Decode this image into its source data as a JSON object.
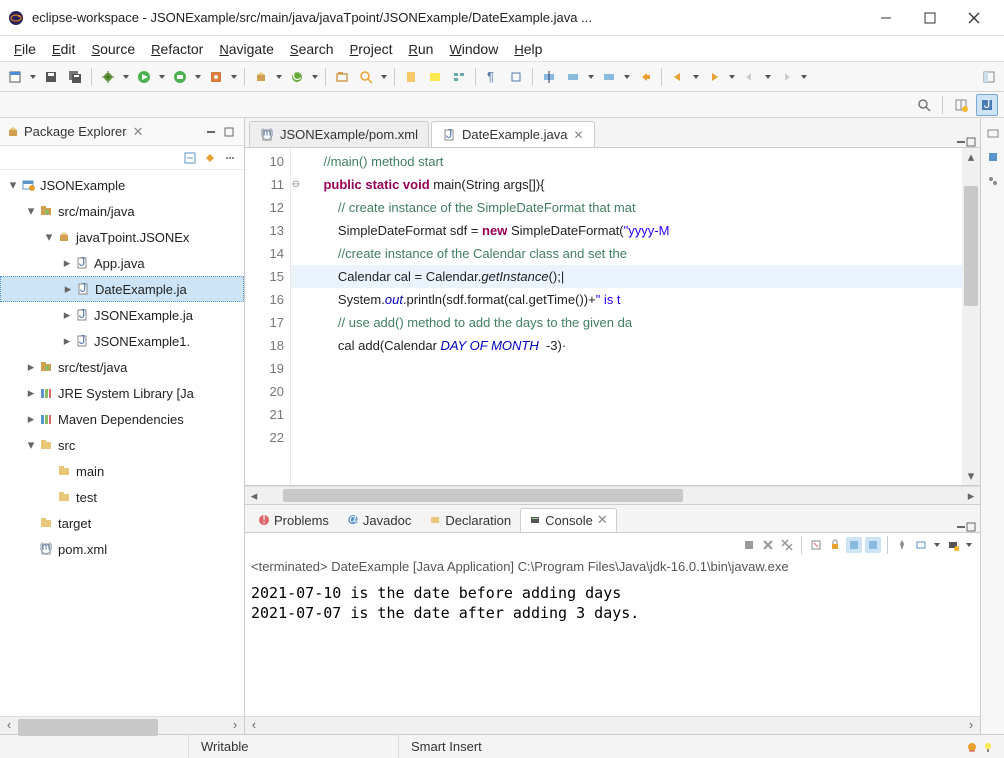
{
  "window": {
    "title": "eclipse-workspace - JSONExample/src/main/java/javaTpoint/JSONExample/DateExample.java ..."
  },
  "menu": [
    "File",
    "Edit",
    "Source",
    "Refactor",
    "Navigate",
    "Search",
    "Project",
    "Run",
    "Window",
    "Help"
  ],
  "packageExplorer": {
    "title": "Package Explorer",
    "items": [
      {
        "depth": 0,
        "exp": "down",
        "icon": "project",
        "label": "JSONExample"
      },
      {
        "depth": 1,
        "exp": "down",
        "icon": "srcfolder",
        "label": "src/main/java"
      },
      {
        "depth": 2,
        "exp": "down",
        "icon": "package",
        "label": "javaTpoint.JSONEx"
      },
      {
        "depth": 3,
        "exp": "right",
        "icon": "jfile",
        "label": "App.java"
      },
      {
        "depth": 3,
        "exp": "right",
        "icon": "jfile",
        "label": "DateExample.ja",
        "selected": true
      },
      {
        "depth": 3,
        "exp": "right",
        "icon": "jfile",
        "label": "JSONExample.ja"
      },
      {
        "depth": 3,
        "exp": "right",
        "icon": "jfile",
        "label": "JSONExample1."
      },
      {
        "depth": 1,
        "exp": "right",
        "icon": "srcfolder",
        "label": "src/test/java"
      },
      {
        "depth": 1,
        "exp": "right",
        "icon": "library",
        "label": "JRE System Library [Ja"
      },
      {
        "depth": 1,
        "exp": "right",
        "icon": "library",
        "label": "Maven Dependencies"
      },
      {
        "depth": 1,
        "exp": "down",
        "icon": "folder",
        "label": "src"
      },
      {
        "depth": 2,
        "exp": "",
        "icon": "folder",
        "label": "main"
      },
      {
        "depth": 2,
        "exp": "",
        "icon": "folder",
        "label": "test"
      },
      {
        "depth": 1,
        "exp": "",
        "icon": "folder",
        "label": "target"
      },
      {
        "depth": 1,
        "exp": "",
        "icon": "xml",
        "label": "pom.xml"
      }
    ]
  },
  "editorTabs": [
    {
      "label": "JSONExample/pom.xml",
      "active": false,
      "icon": "xml"
    },
    {
      "label": "DateExample.java",
      "active": true,
      "icon": "jfile",
      "close": true
    }
  ],
  "code": {
    "startLine": 10,
    "lines": [
      {
        "n": 10,
        "html": "    <span class='cm'>//main() method start</span>"
      },
      {
        "n": 11,
        "html": "    <span class='kw'>public static void</span> main(String args[]){",
        "minus": true
      },
      {
        "n": 12,
        "html": ""
      },
      {
        "n": 13,
        "html": "        <span class='cm'>// create instance of the SimpleDateFormat that mat</span>"
      },
      {
        "n": 14,
        "html": "        SimpleDateFormat sdf = <span class='kw'>new</span> SimpleDateFormat(<span class='str'>\"yyyy-M</span>"
      },
      {
        "n": 15,
        "html": ""
      },
      {
        "n": 16,
        "html": "        <span class='cm'>//create instance of the Calendar class and set the</span>"
      },
      {
        "n": 17,
        "html": "        Calendar cal = Calendar.<span class='it'>getInstance</span>();|",
        "hl": true
      },
      {
        "n": 18,
        "html": ""
      },
      {
        "n": 19,
        "html": "        System.<span class='st'>out</span>.println(sdf.format(cal.getTime())+<span class='str'>\" is t</span>"
      },
      {
        "n": 20,
        "html": ""
      },
      {
        "n": 21,
        "html": "        <span class='cm'>// use add() method to add the days to the given da</span>"
      },
      {
        "n": 22,
        "html": "        cal add(Calendar <span class='st'>DAY OF MONTH</span>  -3)·"
      }
    ]
  },
  "bottomTabs": [
    {
      "label": "Problems",
      "icon": "problems"
    },
    {
      "label": "Javadoc",
      "icon": "javadoc"
    },
    {
      "label": "Declaration",
      "icon": "declaration"
    },
    {
      "label": "Console",
      "icon": "console",
      "active": true,
      "close": true
    }
  ],
  "console": {
    "status": "<terminated> DateExample [Java Application] C:\\Program Files\\Java\\jdk-16.0.1\\bin\\javaw.exe",
    "lines": [
      "2021-07-10 is the date before adding days",
      "2021-07-07 is the date after adding 3 days."
    ]
  },
  "statusbar": {
    "writable": "Writable",
    "insert": "Smart Insert"
  }
}
